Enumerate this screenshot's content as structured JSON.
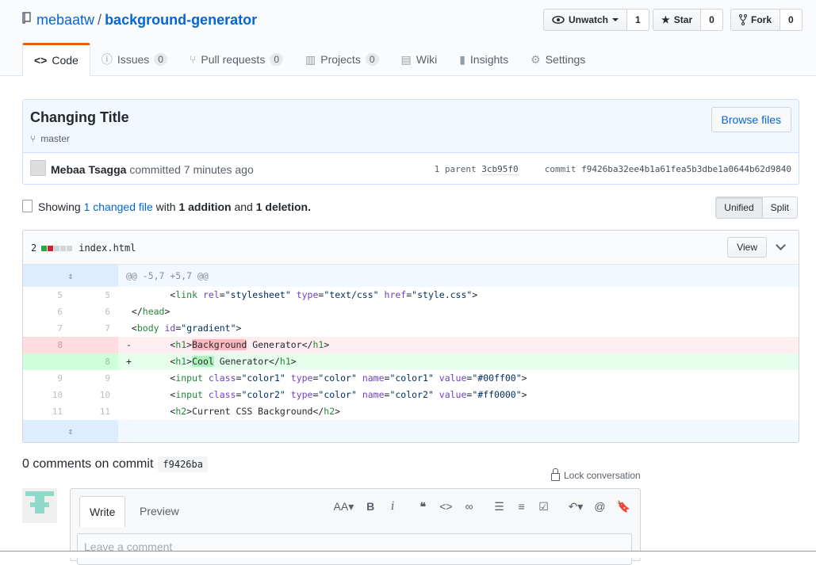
{
  "repo": {
    "owner": "mebaatw",
    "separator": "/",
    "name": "background-generator"
  },
  "actions": [
    {
      "label": "Unwatch",
      "count": "1",
      "icon": "eye-icon"
    },
    {
      "label": "Star",
      "count": "0",
      "icon": "star-icon"
    },
    {
      "label": "Fork",
      "count": "0",
      "icon": "fork-icon"
    }
  ],
  "nav": {
    "code": "Code",
    "issues": "Issues",
    "issues_count": "0",
    "pulls": "Pull requests",
    "pulls_count": "0",
    "projects": "Projects",
    "projects_count": "0",
    "wiki": "Wiki",
    "insights": "Insights",
    "settings": "Settings"
  },
  "commit": {
    "title": "Changing Title",
    "branch": "master",
    "browse": "Browse files",
    "author": "Mebaa Tsagga",
    "action": "committed 7 minutes ago",
    "parents_label": "1 parent",
    "parent_sha": "3cb95f0",
    "commit_label": "commit",
    "sha": "f9426ba32ee4b1a61fea5b3dbe1a0644b62d9840"
  },
  "toc": {
    "showing": "Showing",
    "changed": "1 changed file",
    "with": "with",
    "additions": "1 addition",
    "and": "and",
    "deletions": "1 deletion.",
    "unified": "Unified",
    "split": "Split"
  },
  "file": {
    "stat": "2",
    "name": "index.html",
    "view": "View",
    "hunk": "@@ -5,7 +5,7 @@"
  },
  "comments": {
    "title": "0 comments on commit",
    "sha": "f9426ba",
    "lock": "Lock conversation",
    "write": "Write",
    "preview": "Preview",
    "placeholder": "Leave a comment"
  },
  "colors": {
    "accent": "#0366d6",
    "tab_border": "#e36209",
    "add": "#28a745",
    "del": "#cb2431"
  }
}
